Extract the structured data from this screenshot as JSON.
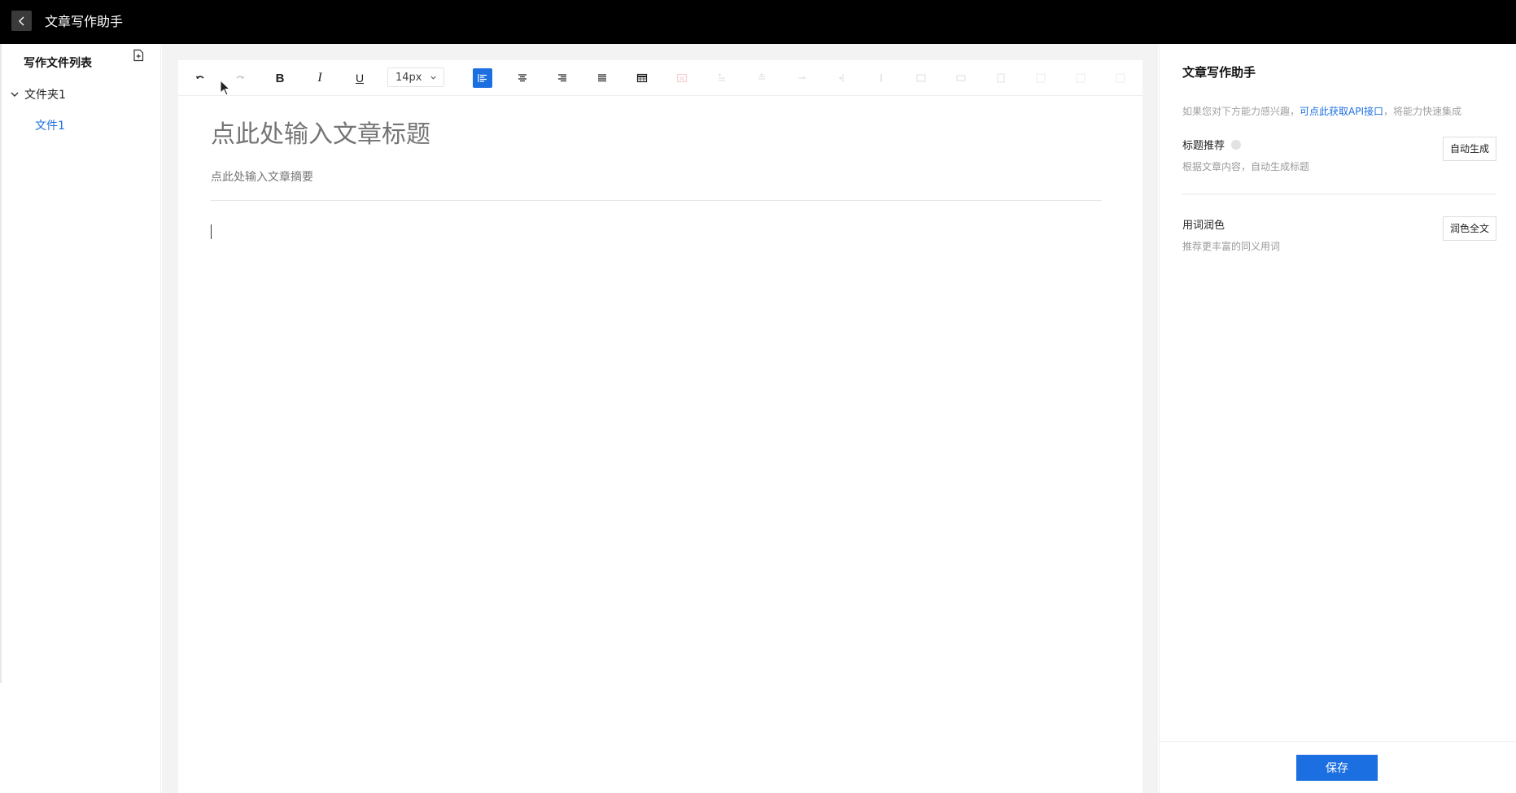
{
  "app": {
    "title": "文章写作助手"
  },
  "sidebar": {
    "title": "写作文件列表",
    "folders": [
      {
        "label": "文件夹1",
        "files": [
          {
            "label": "文件1",
            "selected": true
          }
        ]
      }
    ]
  },
  "toolbar": {
    "font_size": "14px",
    "bold_label": "B",
    "italic_label": "I",
    "underline_label": "U"
  },
  "editor": {
    "title_placeholder": "点此处输入文章标题",
    "summary_placeholder": "点此处输入文章摘要"
  },
  "assistant": {
    "title": "文章写作助手",
    "hint_prefix": "如果您对下方能力感兴趣，",
    "hint_link": "可点此获取API接口",
    "hint_suffix": "，将能力快速集成",
    "sections": [
      {
        "title": "标题推荐",
        "desc": "根据文章内容，自动生成标题",
        "button": "自动生成"
      },
      {
        "title": "用词润色",
        "desc": "推荐更丰富的同义用词",
        "button": "润色全文"
      }
    ],
    "save_label": "保存"
  },
  "colors": {
    "topbar": "#000000",
    "accent": "#1b6fe0",
    "workspace": "#f3f3f3"
  }
}
